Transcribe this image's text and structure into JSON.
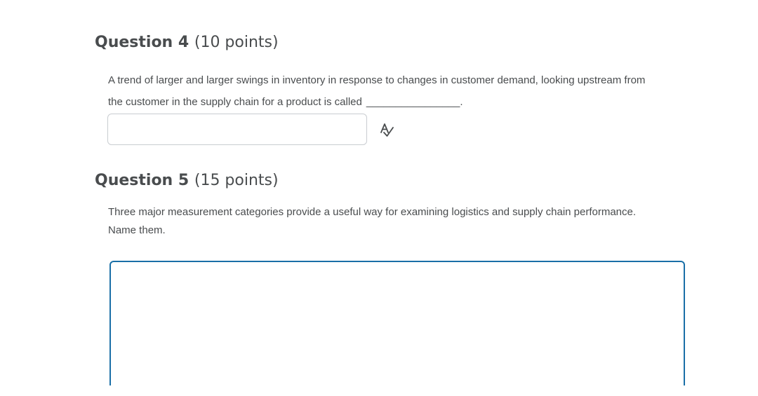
{
  "question4": {
    "name": "Question 4",
    "points": "(10 points)",
    "text_line1": "A trend of larger and larger swings in inventory in response to changes in customer demand, looking upstream from",
    "text_line2": "the customer in the supply chain for a product is called",
    "blank": "________________.",
    "answer_value": "",
    "spellcheck_icon": "spellcheck-icon"
  },
  "question5": {
    "name": "Question 5",
    "points": "(15 points)",
    "text_line1": "Three major measurement categories provide a useful way for examining logistics and supply chain performance.",
    "text_line2": "Name them.",
    "answer_value": ""
  },
  "colors": {
    "text": "#494c4e",
    "input_border": "#c9cdd1",
    "essay_border": "#1a6fa7"
  }
}
